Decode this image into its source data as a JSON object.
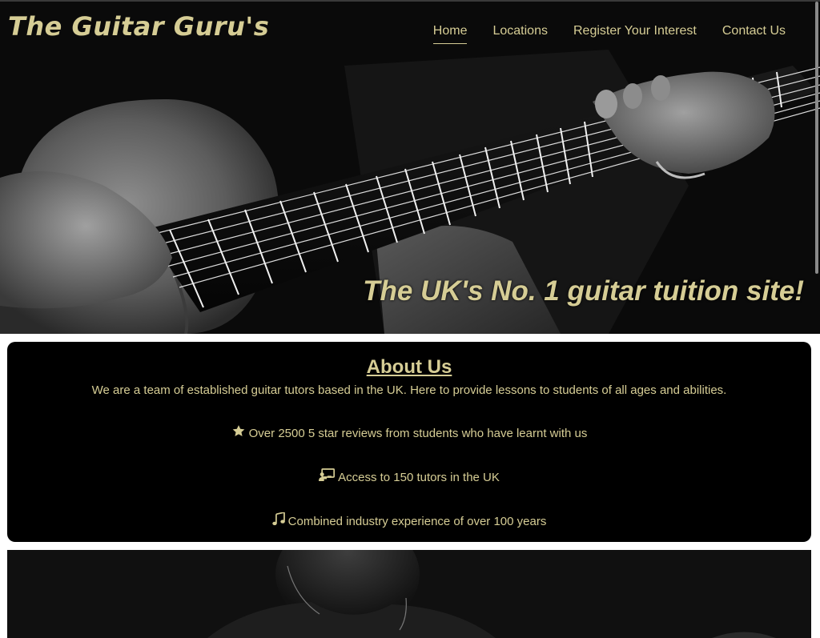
{
  "header": {
    "brand": "The Guitar Guru's",
    "nav": [
      {
        "label": "Home",
        "active": true
      },
      {
        "label": "Locations",
        "active": false
      },
      {
        "label": "Register Your Interest",
        "active": false
      },
      {
        "label": "Contact Us",
        "active": false
      }
    ]
  },
  "hero": {
    "tagline": "The UK's No. 1 guitar tuition site!"
  },
  "about": {
    "title": "About Us",
    "intro": "We are a team of established guitar tutors based in the UK. Here to provide lessons to students of all ages and abilities.",
    "facts": [
      {
        "icon": "star-icon",
        "text": "Over 2500 5 star reviews from students who have learnt with us"
      },
      {
        "icon": "teacher-icon",
        "text": "Access to 150 tutors in the UK"
      },
      {
        "icon": "music-note-icon",
        "text": "Combined industry experience of over 100 years"
      }
    ]
  },
  "colors": {
    "accent": "#d6cd95",
    "panel": "#000000"
  }
}
